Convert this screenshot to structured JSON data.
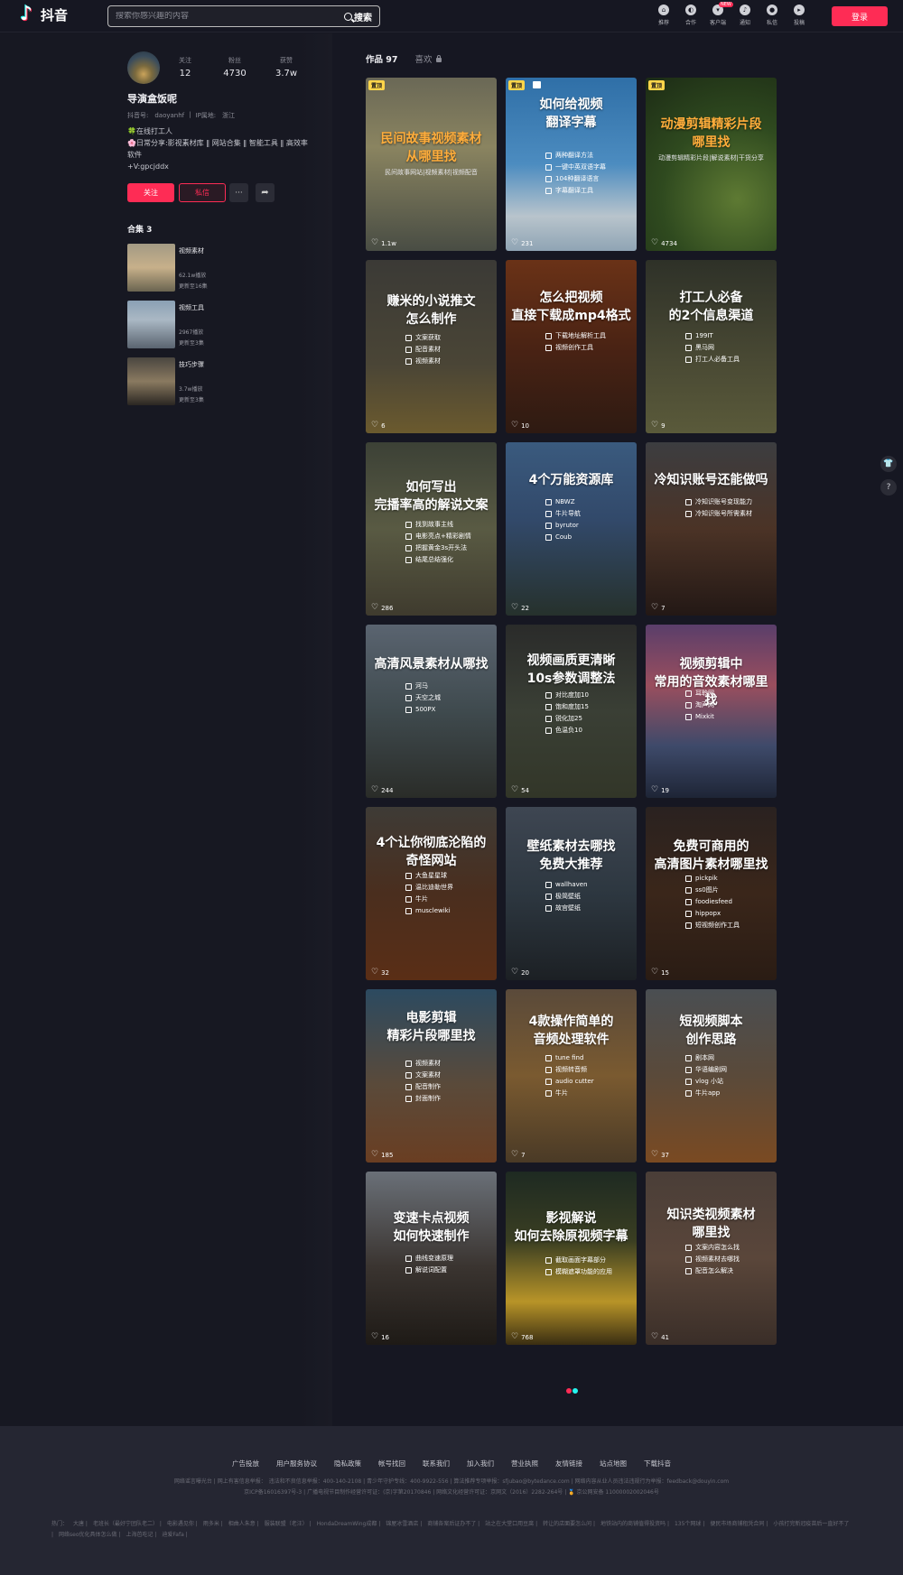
{
  "header": {
    "logo_text": "抖音",
    "search_placeholder": "搜索你感兴趣的内容",
    "search_button": "搜索",
    "nav": [
      {
        "label": "推荐",
        "icon": "home-icon"
      },
      {
        "label": "合作",
        "icon": "cooperation-icon"
      },
      {
        "label": "客户端",
        "icon": "client-download-icon",
        "badge": "NEW"
      },
      {
        "label": "通知",
        "icon": "bell-icon"
      },
      {
        "label": "私信",
        "icon": "message-icon"
      },
      {
        "label": "投稿",
        "icon": "upload-icon"
      }
    ],
    "login_button": "登录"
  },
  "profile": {
    "stats": [
      {
        "label": "关注",
        "value": "12"
      },
      {
        "label": "粉丝",
        "value": "4730"
      },
      {
        "label": "获赞",
        "value": "3.7w"
      }
    ],
    "name": "导演盒饭呢",
    "douyin_id": "抖音号:　daoyanhf",
    "ip_location": "IP属地:　浙江",
    "bio_line1_icon": "🍀",
    "bio_line1": "在线打工人",
    "bio_line2_icon": "🌸",
    "bio_line2": "日常分享:影视素材库 ‖ 网站合集 ‖ 智能工具 ‖ 高效率软件",
    "bio_line3": "+V:gpcjddx",
    "follow_button": "关注",
    "message_button": "私信",
    "more_button": "···",
    "share_icon": "share-icon"
  },
  "collections": {
    "title": "合集 3",
    "items": [
      {
        "name": "视频素材",
        "plays": "62.1w播放",
        "updated": "更新至16集"
      },
      {
        "name": "视频工具",
        "plays": "2967播放",
        "updated": "更新至3集"
      },
      {
        "name": "技巧步骤",
        "plays": "3.7w播放",
        "updated": "更新至3集"
      }
    ]
  },
  "tabs": {
    "works": "作品 97",
    "likes": "喜欢"
  },
  "videos": [
    {
      "pin": "置顶",
      "title": "民间故事视频素材\n从哪里找",
      "sub": "民间故事网站|视频素材|视频配音",
      "likes": "1.1w"
    },
    {
      "pin": "置顶",
      "title": "如何给视频\n翻译字幕",
      "items": [
        "两种翻译方法",
        "一键中英双语字幕",
        "104种翻译语言",
        "字幕翻译工具"
      ],
      "likes": "231"
    },
    {
      "pin": "置顶",
      "title": "动漫剪辑精彩片段\n哪里找",
      "sub": "动漫剪辑精彩片段|解说素材|干货分享",
      "likes": "4734"
    },
    {
      "title": "赚米的小说推文\n怎么制作",
      "items": [
        "文案获取",
        "配音素材",
        "视频素材"
      ],
      "likes": "6"
    },
    {
      "title": "怎么把视频\n直接下载成mp4格式",
      "items": [
        "下载地址解析工具",
        "视频创作工具"
      ],
      "likes": "10"
    },
    {
      "title": "打工人必备\n的2个信息渠道",
      "items": [
        "199IT",
        "黑马网",
        "打工人必备工具"
      ],
      "likes": "9"
    },
    {
      "title": "如何写出\n完播率高的解说文案",
      "items": [
        "找到故事主线",
        "电影亮点+精彩剧情",
        "把握黄金3s开头法",
        "结尾总结强化"
      ],
      "likes": "286"
    },
    {
      "title": "4个万能资源库",
      "items": [
        "NBWZ",
        "牛片导航",
        "byrutor",
        "Coub"
      ],
      "likes": "22"
    },
    {
      "title": "冷知识账号还能做吗",
      "items": [
        "冷知识账号变现能力",
        "冷知识账号所需素材"
      ],
      "likes": "7"
    },
    {
      "title": "高清风景素材从哪找",
      "items": [
        "河马",
        "天空之城",
        "500PX"
      ],
      "likes": "244"
    },
    {
      "title": "视频画质更清晰\n10s参数调整法",
      "items": [
        "对比度加10",
        "饱和度加15",
        "锐化加25",
        "色温负10"
      ],
      "likes": "54"
    },
    {
      "title": "视频剪辑中\n常用的音效素材哪里找",
      "items": [
        "耳聆网",
        "淘声网",
        "Mixkit"
      ],
      "likes": "19"
    },
    {
      "title": "4个让你彻底沦陷的\n奇怪网站",
      "items": [
        "大鱼星星球",
        "温比迪勒世界",
        "牛片",
        "musclewiki"
      ],
      "likes": "32"
    },
    {
      "title": "壁纸素材去哪找\n免费大推荐",
      "items": [
        "wallhaven",
        "极简壁纸",
        "故宫壁纸"
      ],
      "likes": "20"
    },
    {
      "title": "免费可商用的\n高清图片素材哪里找",
      "items": [
        "pickpik",
        "ss0图片",
        "foodiesfeed",
        "hippopx",
        "短视频创作工具"
      ],
      "likes": "15"
    },
    {
      "title": "电影剪辑\n精彩片段哪里找",
      "items": [
        "视频素材",
        "文案素材",
        "配音制作",
        "封面制作"
      ],
      "likes": "185"
    },
    {
      "title": "4款操作简单的\n音频处理软件",
      "items": [
        "tune find",
        "视频转音频",
        "audio cutter",
        "牛片"
      ],
      "likes": "7"
    },
    {
      "title": "短视频脚本\n创作思路",
      "items": [
        "剧本网",
        "华语编剧网",
        "vlog 小站",
        "牛片app"
      ],
      "likes": "37"
    },
    {
      "title": "变速卡点视频\n如何快速制作",
      "items": [
        "曲线变速原理",
        "解说词配置"
      ],
      "likes": "16"
    },
    {
      "title": "影视解说\n如何去除原视频字幕",
      "items": [
        "截取画面字幕部分",
        "模糊遮罩功能的应用"
      ],
      "likes": "768"
    },
    {
      "title": "知识类视频素材\n哪里找",
      "items": [
        "文案内容怎么找",
        "视频素材去哪找",
        "配音怎么解决"
      ],
      "likes": "41"
    }
  ],
  "footer": {
    "links": [
      "广告投放",
      "用户服务协议",
      "隐私政策",
      "帐号找回",
      "联系我们",
      "加入我们",
      "营业执照",
      "友情链接",
      "站点地图",
      "下载抖音"
    ],
    "legal_line1": "网络谣言曝光台 | 网上有害信息举报：　违法和不良信息举报：400-140-2108 | 青少年守护专线：400-9922-556 | 算法推荐专项举报：sfjubao@bytedance.com | 网络内容从业人员违法违规行为举报：feedback@douyin.com",
    "legal_line2": "京ICP备16016397号-3 | 广播电视节目制作经营许可证：(京)字第20170846 | 网络文化经营许可证：京网文（2016）2282-264号 | 🏅 京公网安备 11000002002046号",
    "hot_label": "热门：",
    "hot": [
      "大唐",
      "老班长（最好宁团队老二）",
      "电影遇见你",
      "雨多米",
      "相曲人朱意",
      "服装联盟（老汪）",
      "HondaDreamWing成都",
      "锦屋冰雪酒店",
      "商铺各案后证办不了",
      "站之在大堂口用豆腐",
      "转让的店面要怎么问",
      "地铁站内的商铺值得投资吗",
      "135个网球",
      "便民市场商铺租凭合同",
      "小孩打完新冠疫苗后一直好不了",
      "网络seo优化具体怎么做",
      "上海芭吃记",
      "迪爱Fafa"
    ]
  }
}
